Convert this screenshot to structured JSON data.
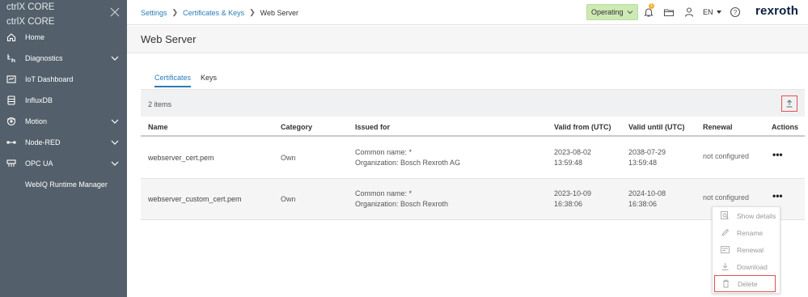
{
  "sidebar": {
    "brand_line1": "ctrlX CORE",
    "brand_line2": "ctrlX CORE",
    "items": [
      {
        "label": "Home",
        "icon": "home-icon"
      },
      {
        "label": "Diagnostics",
        "icon": "diagnostics-icon",
        "expandable": true
      },
      {
        "label": "IoT Dashboard",
        "icon": "dashboard-icon"
      },
      {
        "label": "InfluxDB",
        "icon": "database-icon"
      },
      {
        "label": "Motion",
        "icon": "motion-icon",
        "expandable": true
      },
      {
        "label": "Node-RED",
        "icon": "node-red-icon",
        "expandable": true
      },
      {
        "label": "OPC UA",
        "icon": "opc-ua-icon",
        "expandable": true
      },
      {
        "label": "WebIQ Runtime Manager",
        "icon": ""
      }
    ],
    "background": "#53606b"
  },
  "topbar": {
    "breadcrumb": [
      "Settings",
      "Certificates & Keys",
      "Web Server"
    ],
    "status": "Operating",
    "status_color": "#cde9b4",
    "notification_count": "1",
    "language": "EN",
    "logo": "rexroth"
  },
  "page": {
    "title": "Web Server"
  },
  "tabs": [
    {
      "label": "Certificates",
      "active": true
    },
    {
      "label": "Keys",
      "active": false
    }
  ],
  "table": {
    "items_count": "2 items",
    "columns": [
      "Name",
      "Category",
      "Issued for",
      "Valid from (UTC)",
      "Valid until (UTC)",
      "Renewal",
      "Actions"
    ],
    "rows": [
      {
        "name": "webserver_cert.pem",
        "category": "Own",
        "issued_line1": "Common name: *",
        "issued_line2": "Organization: Bosch Rexroth AG",
        "from_date": "2023-08-02",
        "from_time": "13:59:48",
        "until_date": "2038-07-29",
        "until_time": "13:59:48",
        "renewal": "not configured",
        "actions": "•••"
      },
      {
        "name": "webserver_custom_cert.pem",
        "category": "Own",
        "issued_line1": "Common name: *",
        "issued_line2": "Organization: Bosch Rexroth",
        "from_date": "2023-10-09",
        "from_time": "16:38:06",
        "until_date": "2024-10-08",
        "until_time": "16:38:06",
        "renewal": "not configured",
        "actions": "•••"
      }
    ]
  },
  "context_menu": {
    "items": [
      {
        "label": "Show details",
        "icon": "search-details-icon"
      },
      {
        "label": "Rename",
        "icon": "pencil-icon"
      },
      {
        "label": "Renewal",
        "icon": "renewal-icon"
      },
      {
        "label": "Download",
        "icon": "download-icon"
      },
      {
        "label": "Delete",
        "icon": "trash-icon"
      }
    ]
  },
  "colors": {
    "accent": "#2b7bb9",
    "highlight_border": "#e05050"
  }
}
